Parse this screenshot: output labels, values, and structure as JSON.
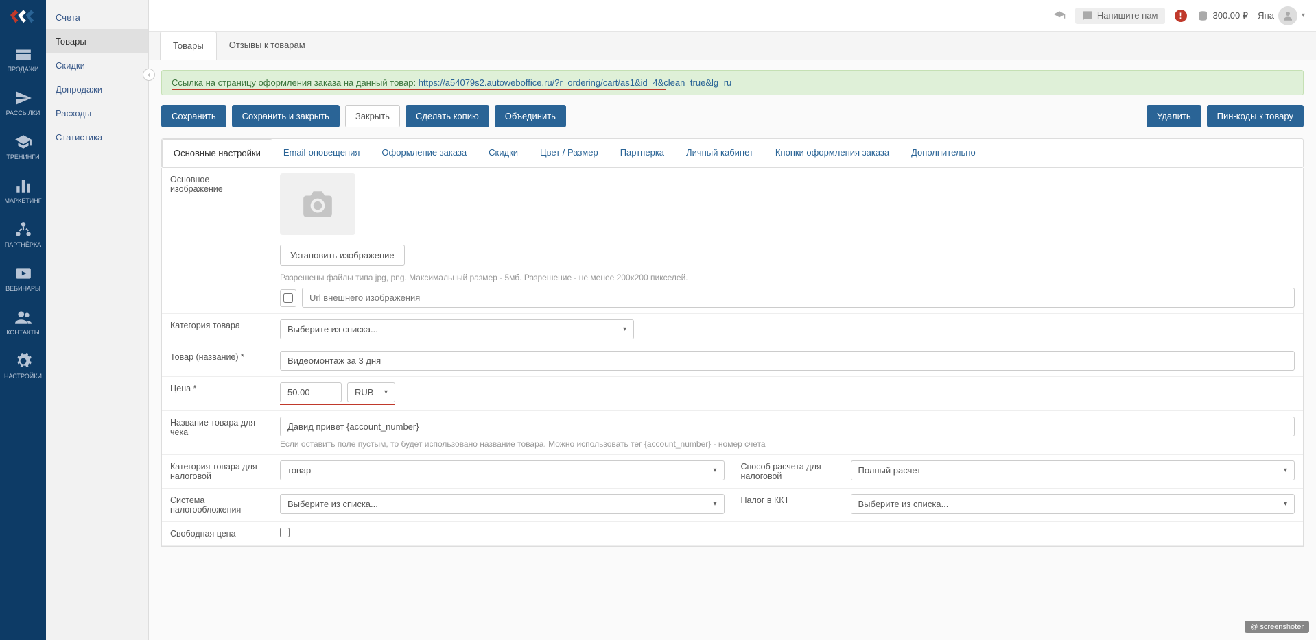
{
  "left_nav": [
    {
      "label": "ПРОДАЖИ"
    },
    {
      "label": "РАССЫЛКИ"
    },
    {
      "label": "ТРЕНИНГИ"
    },
    {
      "label": "МАРКЕТИНГ"
    },
    {
      "label": "ПАРТНЁРКА"
    },
    {
      "label": "ВЕБИНАРЫ"
    },
    {
      "label": "КОНТАКТЫ"
    },
    {
      "label": "НАСТРОЙКИ"
    }
  ],
  "sub_sidebar": [
    "Счета",
    "Товары",
    "Скидки",
    "Допродажи",
    "Расходы",
    "Статистика"
  ],
  "header": {
    "write_us": "Напишите нам",
    "balance": "300.00 ₽",
    "user": "Яна"
  },
  "top_tabs": [
    "Товары",
    "Отзывы к товарам"
  ],
  "info_bar": {
    "prefix": "Ссылка на страницу оформления заказа на данный товар: ",
    "link": "https://a54079s2.autoweboffice.ru/?r=ordering/cart/as1&id=4&clean=true&lg=ru"
  },
  "actions": {
    "save": "Сохранить",
    "save_close": "Сохранить и закрыть",
    "close": "Закрыть",
    "copy": "Сделать копию",
    "merge": "Объединить",
    "delete": "Удалить",
    "pins": "Пин-коды к товару"
  },
  "form_tabs": [
    "Основные настройки",
    "Email-оповещения",
    "Оформление заказа",
    "Скидки",
    "Цвет / Размер",
    "Партнерка",
    "Личный кабинет",
    "Кнопки оформления заказа",
    "Дополнительно"
  ],
  "form": {
    "main_image_label": "Основное изображение",
    "set_image_btn": "Установить изображение",
    "image_hint": "Разрешены файлы типа jpg, png. Максимальный размер - 5мб. Разрешение - не менее 200x200 пикселей.",
    "url_placeholder": "Url внешнего изображения",
    "category_label": "Категория товара",
    "category_placeholder": "Выберите из списка...",
    "name_label": "Товар (название) *",
    "name_value": "Видеомонтаж за 3 дня",
    "price_label": "Цена *",
    "price_value": "50.00",
    "currency": "RUB",
    "receipt_name_label": "Название товара для чека",
    "receipt_name_value": "Давид привет {account_number}",
    "receipt_name_hint": "Если оставить поле пустым, то будет использовано название товара. Можно использовать тег {account_number} - номер счета",
    "tax_category_label": "Категория товара для налоговой",
    "tax_category_value": "товар",
    "payment_method_label": "Способ расчета для налоговой",
    "payment_method_value": "Полный расчет",
    "tax_system_label": "Система налогообложения",
    "tax_system_placeholder": "Выберите из списка...",
    "kkt_tax_label": "Налог в ККТ",
    "kkt_tax_placeholder": "Выберите из списка...",
    "free_price_label": "Свободная цена"
  },
  "watermark": "@ screenshoter"
}
